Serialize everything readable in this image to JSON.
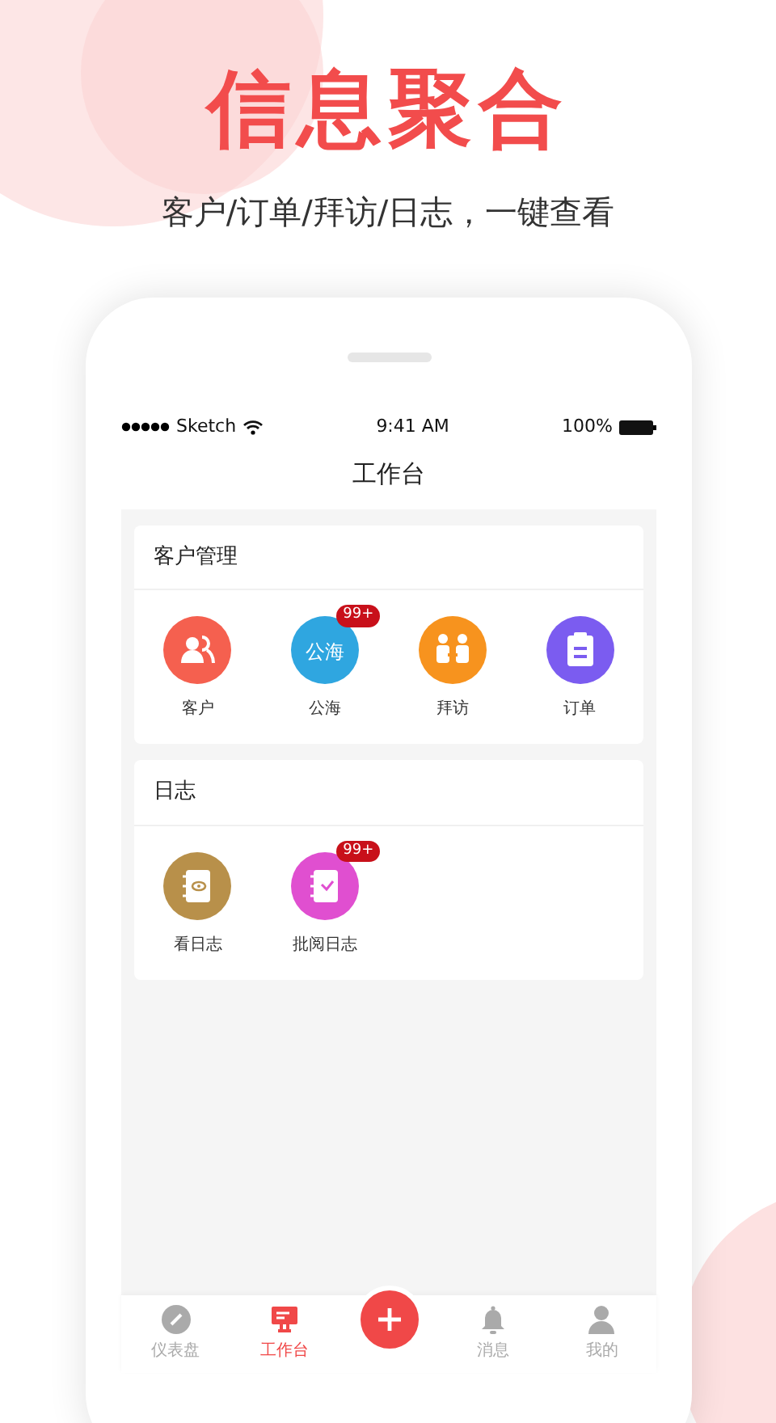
{
  "headline": "信息聚合",
  "subtitle": "客户/订单/拜访/日志，一键查看",
  "status_bar": {
    "carrier": "Sketch",
    "time": "9:41 AM",
    "battery": "100%"
  },
  "screen_title": "工作台",
  "sections": [
    {
      "title": "客户管理",
      "items": [
        {
          "label": "客户",
          "kind": "people",
          "color": "#f5604f"
        },
        {
          "label": "公海",
          "kind": "text",
          "icon_text": "公海",
          "badge": "99+",
          "color": "#2fa6e0"
        },
        {
          "label": "拜访",
          "kind": "meeting",
          "color": "#f7931e"
        },
        {
          "label": "订单",
          "kind": "clipboard",
          "color": "#7b5cf0"
        }
      ]
    },
    {
      "title": "日志",
      "items": [
        {
          "label": "看日志",
          "kind": "notebook-eye",
          "color": "#b8904a"
        },
        {
          "label": "批阅日志",
          "kind": "notebook-check",
          "badge": "99+",
          "color": "#e04fd0"
        }
      ]
    }
  ],
  "tab_bar": [
    {
      "kind": "gauge",
      "label": "仪表盘",
      "selected": false
    },
    {
      "kind": "monitor",
      "label": "工作台",
      "selected": true
    },
    {
      "kind": "add"
    },
    {
      "kind": "bell",
      "label": "消息",
      "selected": false
    },
    {
      "kind": "person",
      "label": "我的",
      "selected": false
    }
  ]
}
